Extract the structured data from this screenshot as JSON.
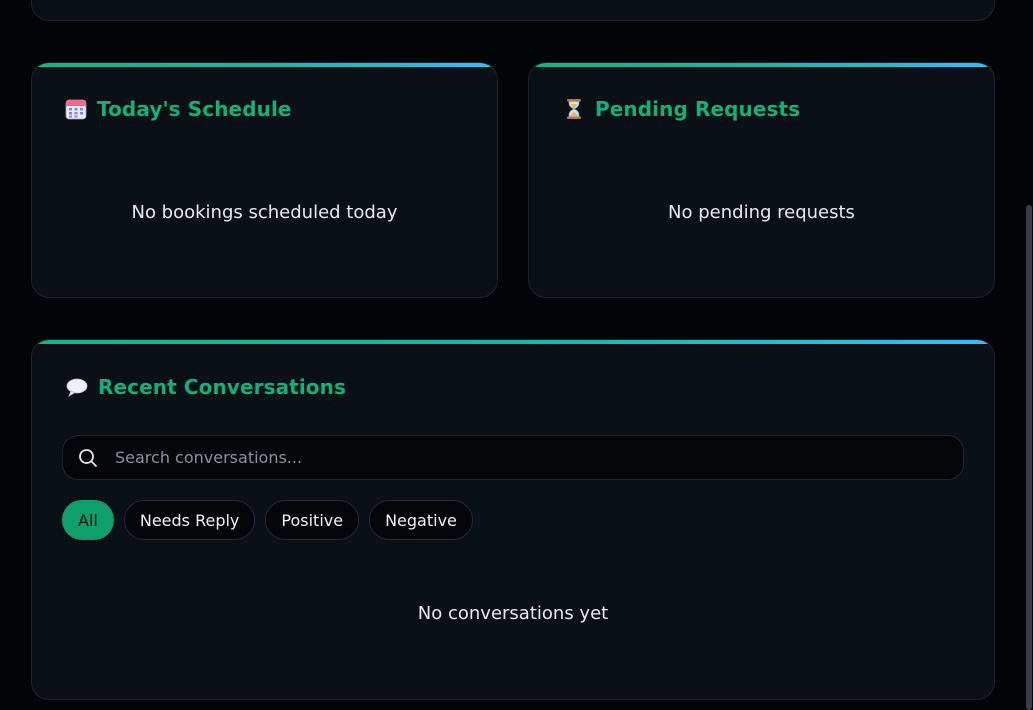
{
  "schedule": {
    "icon": "calendar-icon",
    "title": "Today's Schedule",
    "empty": "No bookings scheduled today"
  },
  "pending": {
    "icon": "hourglass-icon",
    "title": "Pending Requests",
    "empty": "No pending requests"
  },
  "conversations": {
    "icon": "speech-bubble-icon",
    "title": "Recent Conversations",
    "search_placeholder": "Search conversations...",
    "filters": [
      "All",
      "Needs Reply",
      "Positive",
      "Negative"
    ],
    "active_filter": "All",
    "empty": "No conversations yet"
  },
  "colors": {
    "accent": "#10b27a",
    "gradient_start": "#10b981",
    "gradient_end": "#38bdf8",
    "card_bg": "#0b0f16",
    "page_bg": "#020407"
  }
}
